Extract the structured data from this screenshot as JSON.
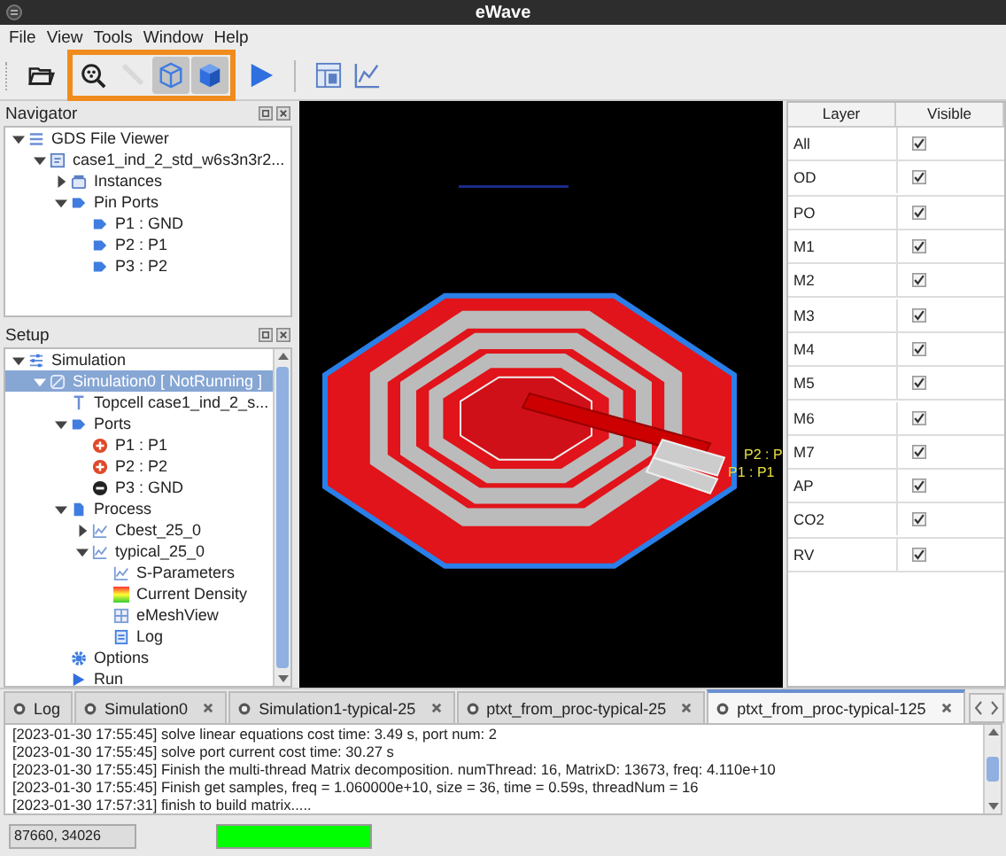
{
  "window": {
    "title": "eWave"
  },
  "menu": [
    "File",
    "View",
    "Tools",
    "Window",
    "Help"
  ],
  "toolbar": [
    {
      "kind": "group",
      "highlighted": false,
      "items": [
        {
          "kind": "open",
          "selected": false,
          "disabled": false
        }
      ]
    },
    {
      "kind": "group",
      "highlighted": true,
      "items": [
        {
          "kind": "zoom",
          "selected": false,
          "disabled": false
        },
        {
          "kind": "ruler",
          "selected": false,
          "disabled": true
        },
        {
          "kind": "cube-outline",
          "selected": true,
          "disabled": false
        },
        {
          "kind": "cube-solid",
          "selected": true,
          "disabled": false
        }
      ]
    },
    {
      "kind": "group",
      "highlighted": false,
      "items": [
        {
          "kind": "run",
          "selected": false,
          "disabled": false
        }
      ]
    },
    {
      "kind": "separator"
    },
    {
      "kind": "group",
      "highlighted": false,
      "items": [
        {
          "kind": "layout",
          "selected": false,
          "disabled": false
        },
        {
          "kind": "chart",
          "selected": false,
          "disabled": false
        }
      ]
    }
  ],
  "navigator": {
    "title": "Navigator",
    "tree": [
      {
        "label": "GDS File Viewer",
        "kind": "list",
        "expanded": true,
        "selected": false,
        "children": [
          {
            "label": "case1_ind_2_std_w6s3n3r2...",
            "kind": "file",
            "expanded": true,
            "selected": false,
            "children": [
              {
                "label": "Instances",
                "kind": "folder",
                "expanded": false,
                "selected": false
              },
              {
                "label": "Pin Ports",
                "kind": "pin",
                "expanded": true,
                "selected": false,
                "children": [
                  {
                    "label": "P1 : GND",
                    "kind": "pin",
                    "selected": false
                  },
                  {
                    "label": "P2 : P1",
                    "kind": "pin",
                    "selected": false
                  },
                  {
                    "label": "P3 : P2",
                    "kind": "pin",
                    "selected": false
                  }
                ]
              }
            ]
          }
        ]
      }
    ]
  },
  "setup": {
    "title": "Setup",
    "tree": [
      {
        "label": "Simulation",
        "kind": "simulation",
        "expanded": true,
        "selected": false,
        "children": [
          {
            "label": "Simulation0 [ NotRunning ]",
            "kind": "sim",
            "expanded": true,
            "selected": true,
            "children": [
              {
                "label": "Topcell case1_ind_2_s...",
                "kind": "topcell",
                "selected": false
              },
              {
                "label": "Ports",
                "kind": "pin",
                "expanded": true,
                "selected": false,
                "children": [
                  {
                    "label": "P1 : P1",
                    "kind": "port-plus",
                    "selected": false
                  },
                  {
                    "label": "P2 : P2",
                    "kind": "port-plus",
                    "selected": false
                  },
                  {
                    "label": "P3 : GND",
                    "kind": "port-minus",
                    "selected": false
                  }
                ]
              },
              {
                "label": "Process",
                "kind": "process",
                "expanded": true,
                "selected": false,
                "children": [
                  {
                    "label": "Cbest_25_0",
                    "kind": "corner",
                    "expanded": false,
                    "selected": false
                  },
                  {
                    "label": "typical_25_0",
                    "kind": "corner",
                    "expanded": true,
                    "selected": false,
                    "children": [
                      {
                        "label": "S-Parameters",
                        "kind": "chart",
                        "selected": false
                      },
                      {
                        "label": "Current Density",
                        "kind": "heatmap",
                        "selected": false
                      },
                      {
                        "label": "eMeshView",
                        "kind": "mesh",
                        "selected": false
                      },
                      {
                        "label": "Log",
                        "kind": "log",
                        "selected": false
                      }
                    ]
                  }
                ]
              },
              {
                "label": "Options",
                "kind": "options",
                "selected": false
              },
              {
                "label": "Run",
                "kind": "run",
                "selected": false
              }
            ]
          }
        ]
      }
    ]
  },
  "viewport": {
    "labels": [
      "P2 : P",
      "P1 : P1"
    ]
  },
  "layers": {
    "columns": [
      "Layer",
      "Visible"
    ],
    "rows": [
      {
        "name": "All",
        "checked": true
      },
      {
        "name": "OD",
        "checked": true
      },
      {
        "name": "PO",
        "checked": true
      },
      {
        "name": "M1",
        "checked": true
      },
      {
        "name": "M2",
        "checked": true
      },
      {
        "name": "M3",
        "checked": true
      },
      {
        "name": "M4",
        "checked": true
      },
      {
        "name": "M5",
        "checked": true
      },
      {
        "name": "M6",
        "checked": true
      },
      {
        "name": "M7",
        "checked": true
      },
      {
        "name": "AP",
        "checked": true
      },
      {
        "name": "CO2",
        "checked": true
      },
      {
        "name": "RV",
        "checked": true
      }
    ]
  },
  "tabs": [
    {
      "label": "Log",
      "closable": false,
      "selected": false
    },
    {
      "label": "Simulation0",
      "closable": true,
      "selected": false
    },
    {
      "label": "Simulation1-typical-25",
      "closable": true,
      "selected": false
    },
    {
      "label": "ptxt_from_proc-typical-25",
      "closable": true,
      "selected": false
    },
    {
      "label": "ptxt_from_proc-typical-125",
      "closable": true,
      "selected": true
    }
  ],
  "log": [
    "[2023-01-30 17:55:45] solve linear equations cost time: 3.49 s, port num: 2",
    "[2023-01-30 17:55:45] solve port current cost time: 30.27 s",
    "[2023-01-30 17:55:45] Finish the multi-thread Matrix decomposition. numThread: 16, MatrixD: 13673, freq: 4.110e+10",
    "[2023-01-30 17:55:45] Finish get samples, freq = 1.060000e+10, size = 36, time = 0.59s, threadNum = 16",
    "[2023-01-30 17:57:31]  finish to build matrix....."
  ],
  "status_bar": {
    "coordinates": "87660, 34026",
    "progress": {
      "level": 1
    }
  }
}
